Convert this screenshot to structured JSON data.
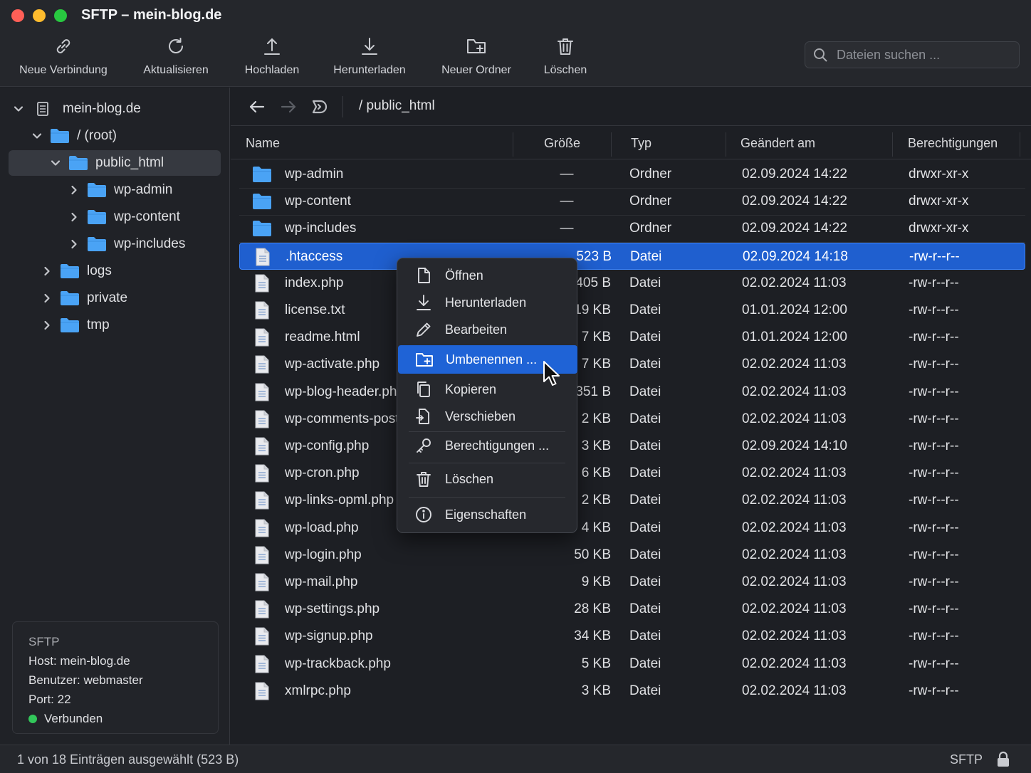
{
  "window": {
    "title": "SFTP – mein-blog.de"
  },
  "toolbar": {
    "new_connection": "Neue Verbindung",
    "refresh": "Aktualisieren",
    "upload": "Hochladen",
    "download": "Herunterladen",
    "new_folder": "Neuer Ordner",
    "delete": "Löschen"
  },
  "search": {
    "placeholder": "Dateien suchen ..."
  },
  "sidebar": {
    "tree": {
      "server": "mein-blog.de",
      "root": "/ (root)",
      "public_html": "public_html",
      "wp_admin": "wp-admin",
      "wp_content": "wp-content",
      "wp_includes": "wp-includes",
      "logs": "logs",
      "private": "private",
      "tmp": "tmp"
    },
    "info": {
      "protocol": "SFTP",
      "host": "Host: mein-blog.de",
      "user": "Benutzer: webmaster",
      "port": "Port: 22",
      "status": "Verbunden",
      "status_color": "#32c75a"
    }
  },
  "pathbar": {
    "path": "/ public_html"
  },
  "table": {
    "headers": {
      "name": "Name",
      "size": "Größe",
      "type": "Typ",
      "modified": "Geändert am",
      "permissions": "Berechtigungen"
    },
    "rows": [
      {
        "name": "wp-admin",
        "size": "—",
        "type": "Ordner",
        "modified": "02.09.2024 14:22",
        "perm": "drwxr-xr-x",
        "kind": "folder"
      },
      {
        "name": "wp-content",
        "size": "—",
        "type": "Ordner",
        "modified": "02.09.2024 14:22",
        "perm": "drwxr-xr-x",
        "kind": "folder"
      },
      {
        "name": "wp-includes",
        "size": "—",
        "type": "Ordner",
        "modified": "02.09.2024 14:22",
        "perm": "drwxr-xr-x",
        "kind": "folder"
      },
      {
        "name": ".htaccess",
        "size": "523 B",
        "type": "Datei",
        "modified": "02.09.2024 14:18",
        "perm": "-rw-r--r--",
        "kind": "file",
        "selected": true
      },
      {
        "name": "index.php",
        "size": "405 B",
        "type": "Datei",
        "modified": "02.02.2024 11:03",
        "perm": "-rw-r--r--",
        "kind": "file"
      },
      {
        "name": "license.txt",
        "size": "19 KB",
        "type": "Datei",
        "modified": "01.01.2024 12:00",
        "perm": "-rw-r--r--",
        "kind": "file"
      },
      {
        "name": "readme.html",
        "size": "7 KB",
        "type": "Datei",
        "modified": "01.01.2024 12:00",
        "perm": "-rw-r--r--",
        "kind": "file"
      },
      {
        "name": "wp-activate.php",
        "size": "7 KB",
        "type": "Datei",
        "modified": "02.02.2024 11:03",
        "perm": "-rw-r--r--",
        "kind": "file"
      },
      {
        "name": "wp-blog-header.php",
        "size": "351 B",
        "type": "Datei",
        "modified": "02.02.2024 11:03",
        "perm": "-rw-r--r--",
        "kind": "file"
      },
      {
        "name": "wp-comments-post.php",
        "size": "2 KB",
        "type": "Datei",
        "modified": "02.02.2024 11:03",
        "perm": "-rw-r--r--",
        "kind": "file"
      },
      {
        "name": "wp-config.php",
        "size": "3 KB",
        "type": "Datei",
        "modified": "02.09.2024 14:10",
        "perm": "-rw-r--r--",
        "kind": "file"
      },
      {
        "name": "wp-cron.php",
        "size": "6 KB",
        "type": "Datei",
        "modified": "02.02.2024 11:03",
        "perm": "-rw-r--r--",
        "kind": "file"
      },
      {
        "name": "wp-links-opml.php",
        "size": "2 KB",
        "type": "Datei",
        "modified": "02.02.2024 11:03",
        "perm": "-rw-r--r--",
        "kind": "file"
      },
      {
        "name": "wp-load.php",
        "size": "4 KB",
        "type": "Datei",
        "modified": "02.02.2024 11:03",
        "perm": "-rw-r--r--",
        "kind": "file"
      },
      {
        "name": "wp-login.php",
        "size": "50 KB",
        "type": "Datei",
        "modified": "02.02.2024 11:03",
        "perm": "-rw-r--r--",
        "kind": "file"
      },
      {
        "name": "wp-mail.php",
        "size": "9 KB",
        "type": "Datei",
        "modified": "02.02.2024 11:03",
        "perm": "-rw-r--r--",
        "kind": "file"
      },
      {
        "name": "wp-settings.php",
        "size": "28 KB",
        "type": "Datei",
        "modified": "02.02.2024 11:03",
        "perm": "-rw-r--r--",
        "kind": "file"
      },
      {
        "name": "wp-signup.php",
        "size": "34 KB",
        "type": "Datei",
        "modified": "02.02.2024 11:03",
        "perm": "-rw-r--r--",
        "kind": "file"
      },
      {
        "name": "wp-trackback.php",
        "size": "5 KB",
        "type": "Datei",
        "modified": "02.02.2024 11:03",
        "perm": "-rw-r--r--",
        "kind": "file"
      },
      {
        "name": "xmlrpc.php",
        "size": "3 KB",
        "type": "Datei",
        "modified": "02.02.2024 11:03",
        "perm": "-rw-r--r--",
        "kind": "file"
      }
    ]
  },
  "context_menu": {
    "open": "Öffnen",
    "download": "Herunterladen",
    "edit": "Bearbeiten",
    "rename": "Umbenennen ...",
    "copy": "Kopieren",
    "move": "Verschieben",
    "permissions": "Berechtigungen ...",
    "delete": "Löschen",
    "properties": "Eigenschaften"
  },
  "statusbar": {
    "selection": "1 von 18 Einträgen ausgewählt (523 B)",
    "protocol": "SFTP"
  },
  "colors": {
    "accent": "#1f63d6",
    "folder": "#4aa3f5"
  }
}
